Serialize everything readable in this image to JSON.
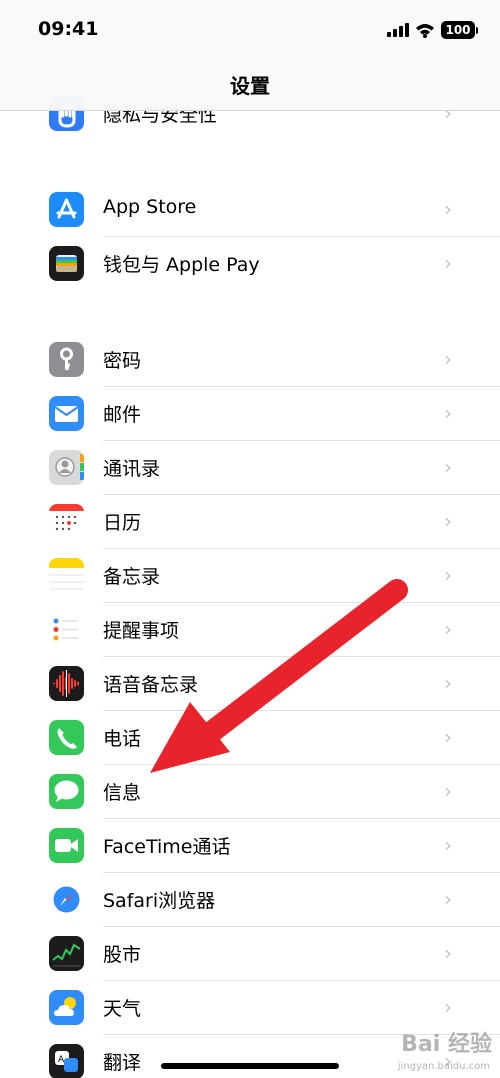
{
  "status": {
    "time": "09:41",
    "battery": "100"
  },
  "nav": {
    "title": "设置"
  },
  "rows": [
    {
      "label": "隐私与安全性",
      "icon": "hand-icon",
      "color": "#2f7bf6"
    },
    {
      "label": "App Store",
      "icon": "app-store-icon",
      "color": "#1d8cf8"
    },
    {
      "label": "钱包与 Apple Pay",
      "icon": "wallet-icon",
      "color": "#1c1c1e"
    },
    {
      "label": "密码",
      "icon": "key-icon",
      "color": "#8e8e93"
    },
    {
      "label": "邮件",
      "icon": "mail-icon",
      "color": "#2f8cf8"
    },
    {
      "label": "通讯录",
      "icon": "contacts-icon",
      "color": "#d9d9d9"
    },
    {
      "label": "日历",
      "icon": "calendar-icon",
      "color": "#ffffff"
    },
    {
      "label": "备忘录",
      "icon": "notes-icon",
      "color": "#ffffff"
    },
    {
      "label": "提醒事项",
      "icon": "reminders-icon",
      "color": "#ffffff"
    },
    {
      "label": "语音备忘录",
      "icon": "voice-memos-icon",
      "color": "#1c1c1e"
    },
    {
      "label": "电话",
      "icon": "phone-icon",
      "color": "#34c759"
    },
    {
      "label": "信息",
      "icon": "messages-icon",
      "color": "#34c759"
    },
    {
      "label": "FaceTime通话",
      "icon": "facetime-icon",
      "color": "#34c759"
    },
    {
      "label": "Safari浏览器",
      "icon": "safari-icon",
      "color": "#ffffff"
    },
    {
      "label": "股市",
      "icon": "stocks-icon",
      "color": "#1c1c1e"
    },
    {
      "label": "天气",
      "icon": "weather-icon",
      "color": "#2f8cf8"
    },
    {
      "label": "翻译",
      "icon": "translate-icon",
      "color": "#1c1c1e"
    }
  ],
  "annotation": {
    "arrow_color": "#e8232b"
  },
  "watermark": {
    "text": "Bai 经验",
    "sub": "jingyan.baidu.com"
  }
}
